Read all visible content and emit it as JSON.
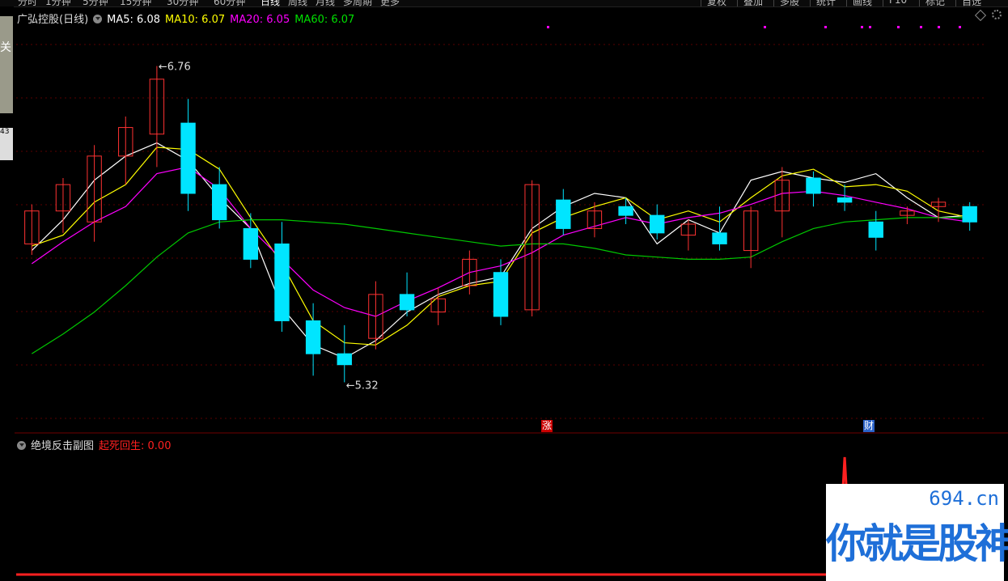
{
  "toolbar": {
    "left_tabs": [
      "分时",
      "1分钟",
      "5分钟",
      "15分钟",
      "30分钟",
      "60分钟",
      "日线",
      "周线",
      "月线",
      "多周期",
      "更多"
    ],
    "right_tabs": [
      "复权",
      "叠加",
      "多股",
      "统计",
      "画线",
      "F10",
      "标记",
      "自选"
    ]
  },
  "left_strip": {
    "label": "关",
    "box_text": "43"
  },
  "main_legend": {
    "stock": "广弘控股(日线)",
    "ma5": "MA5: 6.08",
    "ma10": "MA10: 6.07",
    "ma20": "MA20: 6.05",
    "ma60": "MA60: 6.07",
    "colors": {
      "ma5": "#ffffff",
      "ma10": "#ffff00",
      "ma20": "#ff00ff",
      "ma60": "#00c800",
      "up": "#ff3232",
      "down": "#00e5ff"
    }
  },
  "sub_legend": {
    "title": "绝境反击副图",
    "indicator": "起死回生: 0.00",
    "indicator_color": "#ff2020"
  },
  "badges": {
    "zhang": "涨",
    "cai": "财"
  },
  "watermark": {
    "url": "694.cn",
    "slogan": "你就是股神"
  },
  "chart_data": [
    {
      "type": "candlestick",
      "title": "广弘控股(日线)",
      "ylim": [
        5.2,
        6.95
      ],
      "grid": true,
      "high_marker": {
        "label": "6.76",
        "value": 6.76
      },
      "low_marker": {
        "label": "5.32",
        "value": 5.32
      },
      "series": [
        {
          "name": "MA5",
          "values": [
            5.92,
            6.06,
            6.24,
            6.35,
            6.41,
            6.33,
            6.16,
            6.02,
            5.66,
            5.49,
            5.43,
            5.51,
            5.64,
            5.72,
            5.77,
            5.8,
            6.02,
            6.12,
            6.18,
            6.16,
            5.95,
            6.06,
            6.0,
            6.24,
            6.28,
            6.25,
            6.23,
            6.27,
            6.16,
            6.07,
            6.08
          ]
        },
        {
          "name": "MA10",
          "values": [
            5.94,
            5.99,
            6.14,
            6.22,
            6.39,
            6.38,
            6.29,
            6.07,
            5.86,
            5.6,
            5.5,
            5.49,
            5.58,
            5.71,
            5.76,
            5.78,
            6.0,
            6.07,
            6.12,
            6.16,
            6.06,
            6.1,
            6.05,
            6.16,
            6.26,
            6.29,
            6.21,
            6.22,
            6.19,
            6.1,
            6.07
          ]
        },
        {
          "name": "MA20",
          "values": [
            5.86,
            5.96,
            6.05,
            6.12,
            6.27,
            6.3,
            6.2,
            6.02,
            5.88,
            5.74,
            5.66,
            5.62,
            5.69,
            5.75,
            5.82,
            5.85,
            5.91,
            5.99,
            6.03,
            6.07,
            6.04,
            6.07,
            6.09,
            6.13,
            6.18,
            6.19,
            6.17,
            6.14,
            6.11,
            6.07,
            6.05
          ]
        },
        {
          "name": "MA60",
          "values": [
            5.45,
            5.54,
            5.64,
            5.76,
            5.89,
            6.0,
            6.05,
            6.06,
            6.06,
            6.05,
            6.04,
            6.02,
            6.0,
            5.98,
            5.96,
            5.94,
            5.95,
            5.95,
            5.93,
            5.9,
            5.89,
            5.88,
            5.88,
            5.89,
            5.96,
            6.02,
            6.05,
            6.06,
            6.07,
            6.07,
            6.07
          ]
        }
      ],
      "candles": [
        {
          "o": 5.95,
          "h": 6.13,
          "l": 5.9,
          "c": 6.1
        },
        {
          "o": 6.1,
          "h": 6.25,
          "l": 6.0,
          "c": 6.22
        },
        {
          "o": 6.05,
          "h": 6.4,
          "l": 5.96,
          "c": 6.35
        },
        {
          "o": 6.35,
          "h": 6.53,
          "l": 6.22,
          "c": 6.48
        },
        {
          "o": 6.45,
          "h": 6.76,
          "l": 6.3,
          "c": 6.7
        },
        {
          "o": 6.5,
          "h": 6.61,
          "l": 6.1,
          "c": 6.18
        },
        {
          "o": 6.22,
          "h": 6.3,
          "l": 6.02,
          "c": 6.06
        },
        {
          "o": 6.02,
          "h": 6.09,
          "l": 5.84,
          "c": 5.88
        },
        {
          "o": 5.95,
          "h": 6.05,
          "l": 5.55,
          "c": 5.6
        },
        {
          "o": 5.6,
          "h": 5.68,
          "l": 5.35,
          "c": 5.45
        },
        {
          "o": 5.45,
          "h": 5.58,
          "l": 5.32,
          "c": 5.4
        },
        {
          "o": 5.52,
          "h": 5.78,
          "l": 5.47,
          "c": 5.72
        },
        {
          "o": 5.72,
          "h": 5.82,
          "l": 5.62,
          "c": 5.65
        },
        {
          "o": 5.64,
          "h": 5.75,
          "l": 5.58,
          "c": 5.7
        },
        {
          "o": 5.76,
          "h": 5.92,
          "l": 5.72,
          "c": 5.88
        },
        {
          "o": 5.82,
          "h": 5.88,
          "l": 5.58,
          "c": 5.62
        },
        {
          "o": 5.65,
          "h": 6.24,
          "l": 5.62,
          "c": 6.22
        },
        {
          "o": 6.15,
          "h": 6.2,
          "l": 5.99,
          "c": 6.02
        },
        {
          "o": 6.02,
          "h": 6.14,
          "l": 5.98,
          "c": 6.1
        },
        {
          "o": 6.12,
          "h": 6.16,
          "l": 6.04,
          "c": 6.08
        },
        {
          "o": 6.08,
          "h": 6.13,
          "l": 5.97,
          "c": 6.0
        },
        {
          "o": 5.99,
          "h": 6.06,
          "l": 5.92,
          "c": 6.04
        },
        {
          "o": 6.0,
          "h": 6.12,
          "l": 5.92,
          "c": 5.95
        },
        {
          "o": 5.92,
          "h": 6.12,
          "l": 5.84,
          "c": 6.1
        },
        {
          "o": 6.1,
          "h": 6.3,
          "l": 5.98,
          "c": 6.24
        },
        {
          "o": 6.25,
          "h": 6.28,
          "l": 6.12,
          "c": 6.18
        },
        {
          "o": 6.16,
          "h": 6.22,
          "l": 6.1,
          "c": 6.14
        },
        {
          "o": 6.05,
          "h": 6.1,
          "l": 5.92,
          "c": 5.98
        },
        {
          "o": 6.08,
          "h": 6.12,
          "l": 6.04,
          "c": 6.1
        },
        {
          "o": 6.12,
          "h": 6.16,
          "l": 6.05,
          "c": 6.14
        },
        {
          "o": 6.12,
          "h": 6.14,
          "l": 6.01,
          "c": 6.05
        }
      ]
    },
    {
      "type": "line",
      "title": "绝境反击副图",
      "series": [
        {
          "name": "起死回生",
          "values": [
            0,
            0,
            0,
            0,
            0,
            0,
            0,
            0,
            0,
            0,
            0,
            0,
            0,
            0,
            0,
            0,
            0,
            0,
            0,
            0,
            0,
            0,
            0,
            0,
            0,
            0,
            1,
            0,
            0,
            0,
            0
          ]
        }
      ],
      "ylim": [
        0,
        1
      ]
    }
  ]
}
